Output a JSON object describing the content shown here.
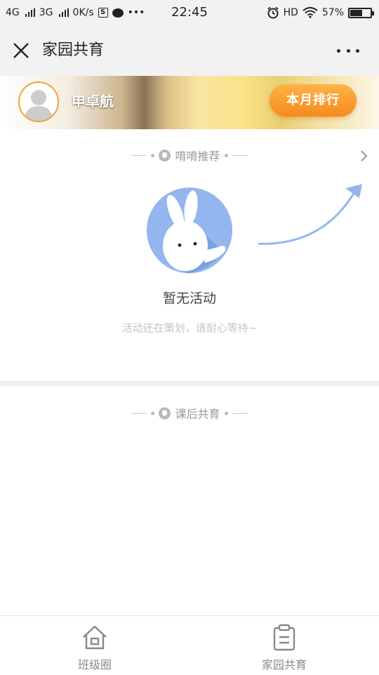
{
  "status_bar": {
    "net1": "4G",
    "net2": "3G",
    "speed": "0K/s",
    "app_badge": "S",
    "more": "•••",
    "time": "22:45",
    "hd": "HD",
    "battery": "57%",
    "battery_level": 0.57
  },
  "header": {
    "title": "家园共育",
    "close_icon": "close-icon",
    "more_icon": "more-icon"
  },
  "banner": {
    "username": "申卓航",
    "rank_button": "本月排行",
    "accent": "#f58a1e"
  },
  "section_recommend": {
    "title": "唷唷推荐",
    "empty_title": "暂无活动",
    "empty_subtitle": "活动还在策划，请耐心等待~"
  },
  "section_after_school": {
    "title": "课后共育"
  },
  "tabbar": {
    "items": [
      {
        "label": "班级圈",
        "icon": "home-icon"
      },
      {
        "label": "家园共育",
        "icon": "clipboard-icon"
      }
    ]
  }
}
